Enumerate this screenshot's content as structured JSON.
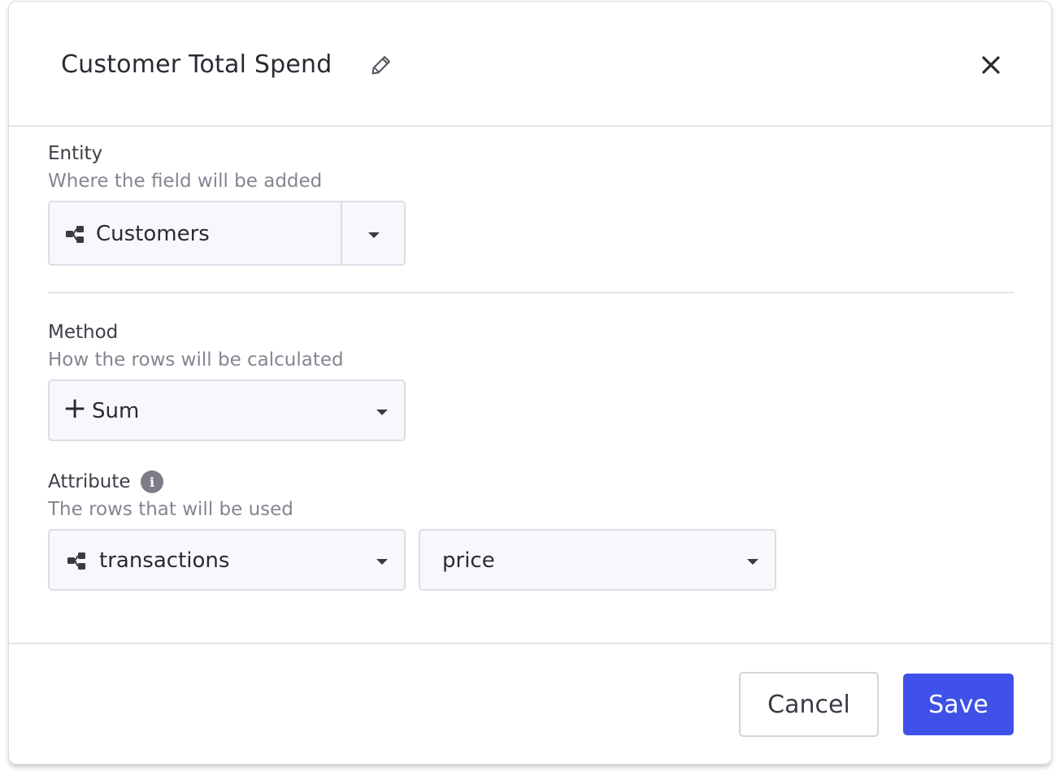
{
  "header": {
    "title": "Customer Total Spend",
    "edit_icon": "pencil-icon",
    "close_icon": "close-icon"
  },
  "entity": {
    "label": "Entity",
    "help": "Where the field will be added",
    "value": "Customers",
    "icon": "entity-icon"
  },
  "method": {
    "label": "Method",
    "help": "How the rows will be calculated",
    "symbol": "+",
    "value": "Sum"
  },
  "attribute": {
    "label": "Attribute",
    "help": "The rows that will be used",
    "info_icon": "info-icon",
    "relation_value": "transactions",
    "field_value": "price"
  },
  "footer": {
    "cancel_label": "Cancel",
    "save_label": "Save"
  },
  "colors": {
    "primary": "#3f51e8",
    "border": "#dcdde5",
    "muted_text": "#858592"
  }
}
